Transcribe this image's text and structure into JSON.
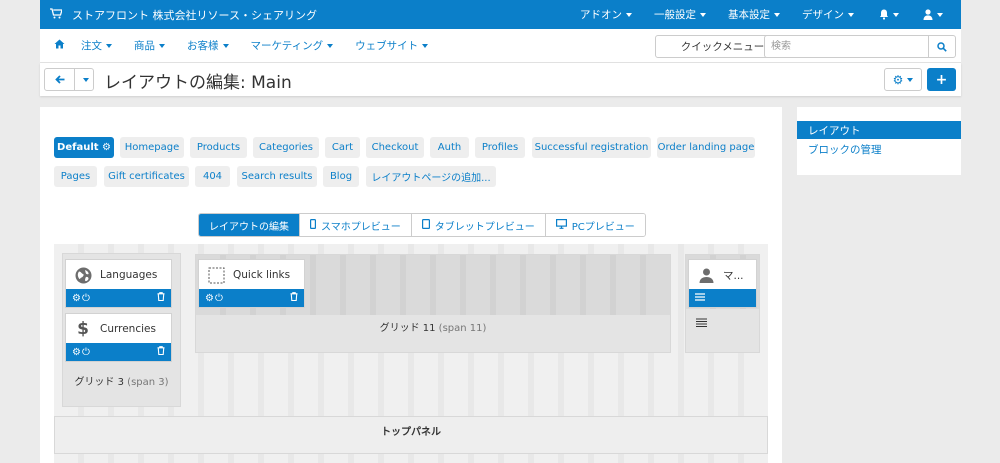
{
  "topbar": {
    "brand": "ストアフロント 株式会社リソース・シェアリング",
    "menus": [
      "アドオン",
      "一般設定",
      "基本設定",
      "デザイン"
    ]
  },
  "nav": {
    "items": [
      "注文",
      "商品",
      "お客様",
      "マーケティング",
      "ウェブサイト"
    ],
    "quick_menu": "クイックメニュー",
    "search_placeholder": "検索"
  },
  "header": {
    "title": "レイアウトの編集: Main"
  },
  "layout_tabs": [
    "Default",
    "Homepage",
    "Products",
    "Categories",
    "Cart",
    "Checkout",
    "Auth",
    "Profiles",
    "Successful registration",
    "Order landing page",
    "Pages",
    "Gift certificates",
    "404",
    "Search results",
    "Blog",
    "レイアウトページの追加..."
  ],
  "modes": [
    "レイアウトの編集",
    "スマホプレビュー",
    "タブレットプレビュー",
    "PCプレビュー"
  ],
  "grids": {
    "left": {
      "name": "グリッド 3",
      "span": "(span 3)"
    },
    "center": {
      "name": "グリッド 11",
      "span": "(span 11)"
    }
  },
  "blocks": {
    "languages": "Languages",
    "currencies": "Currencies",
    "quick_links": "Quick links",
    "my_account": "マ..."
  },
  "top_panel": "トップパネル",
  "sidebar": {
    "items": [
      "レイアウト",
      "ブロックの管理"
    ]
  },
  "colors": {
    "accent": "#0b7fc9"
  }
}
